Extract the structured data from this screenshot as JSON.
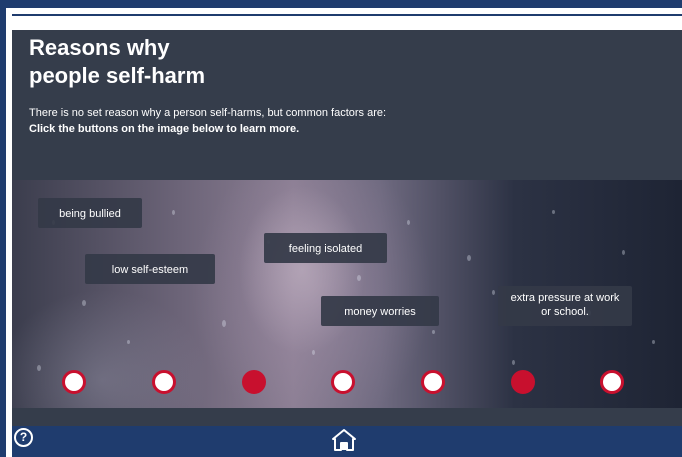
{
  "page": {
    "title": "Reasons why\npeople self-harm",
    "intro": "There is no set reason why a person self-harms, but common factors are:",
    "instruction": "Click the buttons on the image below to learn more."
  },
  "labels": [
    "being bullied",
    "low self-esteem",
    "feeling isolated",
    "money worries",
    "extra pressure at work or school."
  ],
  "hotspots": [
    {
      "state": "unvisited"
    },
    {
      "state": "unvisited"
    },
    {
      "state": "selected"
    },
    {
      "state": "unvisited"
    },
    {
      "state": "unvisited"
    },
    {
      "state": "selected"
    },
    {
      "state": "unvisited"
    }
  ],
  "nav": {
    "help_icon": "help-icon",
    "help_glyph": "?",
    "home_icon": "home-icon"
  },
  "colors": {
    "brand_blue": "#1f3c6e",
    "panel": "#353d4b",
    "accent_red": "#c8102e"
  }
}
